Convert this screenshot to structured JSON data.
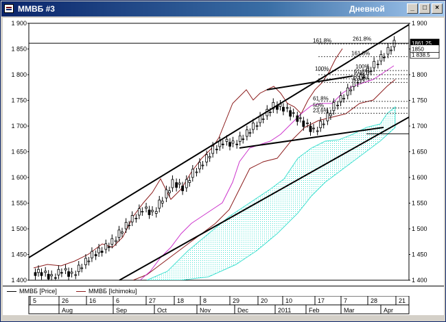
{
  "window": {
    "title": "ММВБ #3",
    "interval": "Дневной",
    "minimize_label": "_",
    "maximize_label": "□",
    "close_label": "×"
  },
  "legend": [
    {
      "label": "ММВБ [Price]",
      "color": "#000000"
    },
    {
      "label": "ММВБ [Ichimoku]",
      "color": "#8b1a1a"
    }
  ],
  "y_axis_labels": [
    "1 900",
    "1 850",
    "1 800",
    "1 750",
    "1 700",
    "1 650",
    "1 600",
    "1 550",
    "1 500",
    "1 450",
    "1 400"
  ],
  "price_boxes": [
    {
      "label": "1861.25",
      "fill": "#000000",
      "text_color": "#ffffff"
    },
    {
      "label": "1 838.5",
      "fill": "#ffffff",
      "text_color": "#000000"
    },
    {
      "label": "1850",
      "fill": "#ffffff",
      "text_color": "#000000"
    }
  ],
  "fib_labels": [
    "161.8%",
    "261.8%",
    "161.8%",
    "100%",
    "61.8%",
    "50%",
    "23.6%",
    "100%",
    "61.8%",
    "50%",
    "23.6%"
  ],
  "time_days": [
    "5",
    "26",
    "16",
    "6",
    "27",
    "18",
    "8",
    "29",
    "20",
    "10",
    "17",
    "7",
    "28",
    "21"
  ],
  "time_months": [
    "Aug",
    "Sep",
    "Oct",
    "Nov",
    "Dec",
    "2011",
    "Feb",
    "Mar",
    "Apr"
  ],
  "colors": {
    "cloud": "#40e0d0",
    "tenkan": "#cc33cc",
    "chikou": "#8b1a1a",
    "kijun": "#8b1a1a"
  },
  "chart_data": {
    "type": "candlestick",
    "instrument": "ММВБ",
    "ylim": [
      1400,
      1900
    ],
    "close_samples": [
      1415,
      1405,
      1420,
      1410,
      1430,
      1450,
      1460,
      1475,
      1500,
      1520,
      1540,
      1530,
      1560,
      1590,
      1580,
      1610,
      1630,
      1655,
      1670,
      1665,
      1680,
      1700,
      1720,
      1740,
      1735,
      1720,
      1705,
      1690,
      1710,
      1740,
      1760,
      1785,
      1800,
      1820,
      1840,
      1861
    ]
  }
}
